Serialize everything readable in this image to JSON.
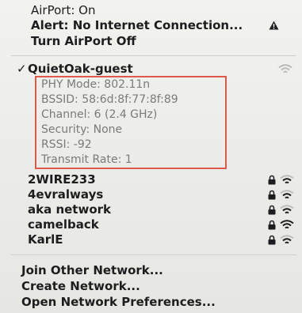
{
  "status": {
    "airport_status": "AirPort: On",
    "alert": "Alert: No Internet Connection...",
    "toggle_label": "Turn AirPort Off"
  },
  "current_network": {
    "checkmark": "✓",
    "name": "QuietOak-guest",
    "details": [
      "PHY Mode: 802.11n",
      "BSSID: 58:6d:8f:77:8f:89",
      "Channel: 6 (2.4 GHz)",
      "Security: None",
      "RSSI: -92",
      "Transmit Rate: 1"
    ]
  },
  "networks": [
    {
      "name": "2WIRE233",
      "locked": true,
      "signal_bars": 2
    },
    {
      "name": "4evralways",
      "locked": true,
      "signal_bars": 2
    },
    {
      "name": "aka network",
      "locked": true,
      "signal_bars": 2
    },
    {
      "name": "camelback",
      "locked": true,
      "signal_bars": 3
    },
    {
      "name": "KarlE",
      "locked": true,
      "signal_bars": 2
    }
  ],
  "actions": {
    "join_other": "Join Other Network...",
    "create": "Create Network...",
    "open_prefs": "Open Network Preferences..."
  },
  "colors": {
    "highlight_box": "#e0574e",
    "detail_text": "#7a7a7a"
  }
}
